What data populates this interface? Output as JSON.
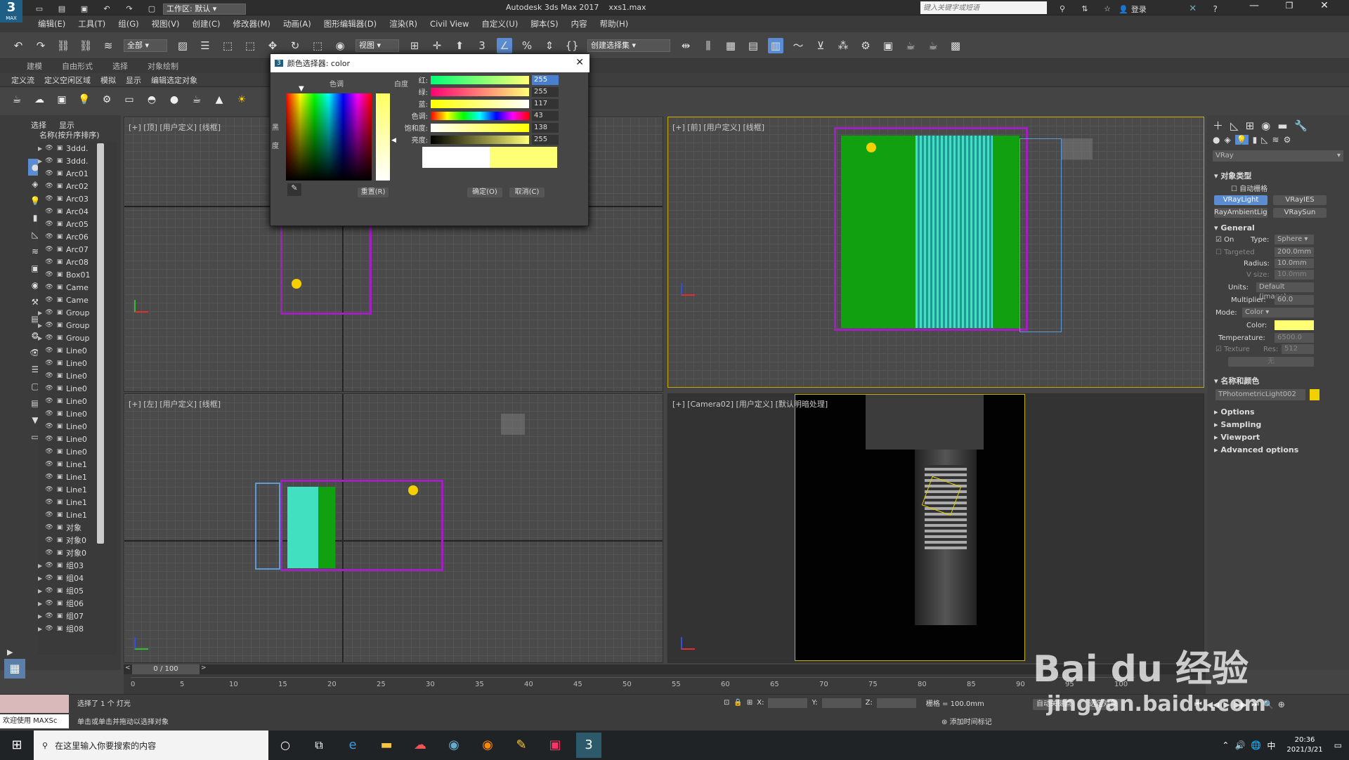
{
  "title": {
    "app_icon": "3",
    "app_icon_sub": "MAX",
    "workspace_label": "工作区: 默认",
    "app_name": "Autodesk 3ds Max 2017",
    "file_name": "xxs1.max",
    "search_placeholder": "键入关键字或短语",
    "login": "登录"
  },
  "menu": [
    "编辑(E)",
    "工具(T)",
    "组(G)",
    "视图(V)",
    "创建(C)",
    "修改器(M)",
    "动画(A)",
    "图形编辑器(D)",
    "渲染(R)",
    "Civil View",
    "自定义(U)",
    "脚本(S)",
    "内容",
    "帮助(H)"
  ],
  "toolbar": {
    "filter": "全部",
    "view_dropdown": "视图",
    "selection_set": "创建选择集"
  },
  "ribbon_tabs": [
    "建模",
    "自由形式",
    "选择",
    "对象绘制"
  ],
  "ribbon_sub": [
    "定义流",
    "定义空闲区域",
    "模拟",
    "显示",
    "编辑选定对象"
  ],
  "scene_explorer": {
    "tabs": [
      "选择",
      "显示"
    ],
    "header": "名称(按升序排序)",
    "items": [
      {
        "name": "3ddd.",
        "expand": true
      },
      {
        "name": "3ddd.",
        "expand": true
      },
      {
        "name": "Arc01",
        "expand": false
      },
      {
        "name": "Arc02",
        "expand": false
      },
      {
        "name": "Arc03",
        "expand": false
      },
      {
        "name": "Arc04",
        "expand": false
      },
      {
        "name": "Arc05",
        "expand": false
      },
      {
        "name": "Arc06",
        "expand": false
      },
      {
        "name": "Arc07",
        "expand": false
      },
      {
        "name": "Arc08",
        "expand": false
      },
      {
        "name": "Box01",
        "expand": false
      },
      {
        "name": "Came",
        "expand": false
      },
      {
        "name": "Came",
        "expand": false
      },
      {
        "name": "Group",
        "expand": true
      },
      {
        "name": "Group",
        "expand": true
      },
      {
        "name": "Group",
        "expand": true
      },
      {
        "name": "Line0",
        "expand": false
      },
      {
        "name": "Line0",
        "expand": false
      },
      {
        "name": "Line0",
        "expand": false
      },
      {
        "name": "Line0",
        "expand": false
      },
      {
        "name": "Line0",
        "expand": false
      },
      {
        "name": "Line0",
        "expand": false
      },
      {
        "name": "Line0",
        "expand": false
      },
      {
        "name": "Line0",
        "expand": false
      },
      {
        "name": "Line0",
        "expand": false
      },
      {
        "name": "Line1",
        "expand": false
      },
      {
        "name": "Line1",
        "expand": false
      },
      {
        "name": "Line1",
        "expand": false
      },
      {
        "name": "Line1",
        "expand": false
      },
      {
        "name": "Line1",
        "expand": false
      },
      {
        "name": "对象",
        "expand": false
      },
      {
        "name": "对象0",
        "expand": false
      },
      {
        "name": "对象0",
        "expand": false
      },
      {
        "name": "组03",
        "expand": true
      },
      {
        "name": "组04",
        "expand": true
      },
      {
        "name": "组05",
        "expand": true
      },
      {
        "name": "组06",
        "expand": true
      },
      {
        "name": "组07",
        "expand": true
      },
      {
        "name": "组08",
        "expand": true
      }
    ]
  },
  "viewports": {
    "top": "[+] [顶] [用户定义] [线框]",
    "front": "[+] [前] [用户定义] [线框]",
    "left": "[+] [左] [用户定义] [线框]",
    "camera": "[+] [Camera02] [用户定义] [默认明暗处理]"
  },
  "color_dialog": {
    "title": "颜色选择器: color",
    "hue_label": "色调",
    "whiteness_label": "白度",
    "black_label": "黑",
    "degree_label": "度",
    "sliders": [
      {
        "label": "红:",
        "value": "255"
      },
      {
        "label": "绿:",
        "value": "255"
      },
      {
        "label": "蓝:",
        "value": "117"
      },
      {
        "label": "色调:",
        "value": "43"
      },
      {
        "label": "饱和度:",
        "value": "138"
      },
      {
        "label": "亮度:",
        "value": "255"
      }
    ],
    "reset": "重置(R)",
    "ok": "确定(O)",
    "cancel": "取消(C)",
    "old_color": "#ffffff",
    "new_color": "#ffff75"
  },
  "command_panel": {
    "renderer": "VRay",
    "object_type": "对象类型",
    "auto_grid": "自动栅格",
    "types": [
      "VRayLight",
      "VRayIES",
      "RayAmbientLigh",
      "VRaySun"
    ],
    "general": "General",
    "on": "On",
    "type_label": "Type:",
    "type_value": "Sphere",
    "targeted": "Targeted",
    "targeted_value": "200.0mm",
    "radius_label": "Radius:",
    "radius_value": "10.0mm",
    "vsize_label": "V size:",
    "vsize_value": "10.0mm",
    "units_label": "Units:",
    "units_value": "Default (image)",
    "multiplier_label": "Multiplier:",
    "multiplier_value": "60.0",
    "mode_label": "Mode:",
    "mode_value": "Color",
    "color_label": "Color:",
    "light_color": "#ffff75",
    "temperature_label": "Temperature:",
    "temperature_value": "6500.0",
    "texture_label": "Texture",
    "res_label": "Res:",
    "res_value": "512",
    "none_label": "无",
    "name_color": "名称和颜色",
    "object_name": "TPhotometricLight002",
    "object_color": "#f0d000",
    "rollouts": [
      "Options",
      "Sampling",
      "Viewport",
      "Advanced options"
    ]
  },
  "timeline": {
    "frame": "0 / 100",
    "ticks": [
      "0",
      "5",
      "10",
      "15",
      "20",
      "25",
      "30",
      "35",
      "40",
      "45",
      "50",
      "55",
      "60",
      "65",
      "70",
      "75",
      "80",
      "85",
      "90",
      "95",
      "100"
    ]
  },
  "status": {
    "welcome": "欢迎使用 MAXSc",
    "selected": "选择了 1 个 灯光",
    "hint": "单击或单击并拖动以选择对象",
    "x_label": "X:",
    "y_label": "Y:",
    "z_label": "Z:",
    "grid": "栅格 = 100.0mm",
    "add_time_tag": "添加时间标记",
    "auto_key": "自动关键点",
    "set_key": "选定对象"
  },
  "taskbar": {
    "search_placeholder": "在这里输入你要搜索的内容",
    "time": "20:36",
    "date": "2021/3/21",
    "ime": "中"
  },
  "watermark": {
    "brand": "Bai  du 经验",
    "url": "jingyan.baidu.com"
  }
}
